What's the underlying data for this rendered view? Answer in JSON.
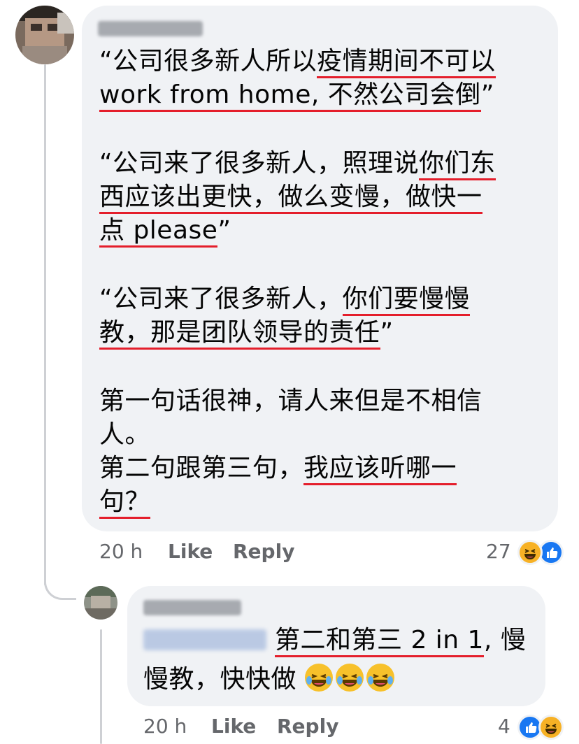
{
  "comment": {
    "author": "",
    "paragraphs": [
      {
        "lines": [
          [
            {
              "t": "“公司很多新人所以",
              "u": false
            },
            {
              "t": "疫情期间不可以",
              "u": true
            }
          ],
          [
            {
              "t": "work from home, 不然公司会倒",
              "u": true
            },
            {
              "t": "”",
              "u": false
            }
          ]
        ]
      },
      {
        "lines": [
          [
            {
              "t": "“公司来了很多新人，照理说",
              "u": false
            },
            {
              "t": "你们东",
              "u": true
            }
          ],
          [
            {
              "t": "西应该出更快，做么变慢，做快一",
              "u": true
            }
          ],
          [
            {
              "t": "点 please",
              "u": true
            },
            {
              "t": "”",
              "u": false
            }
          ]
        ]
      },
      {
        "lines": [
          [
            {
              "t": "“公司来了很多新人，",
              "u": false
            },
            {
              "t": "你们要慢慢",
              "u": true
            }
          ],
          [
            {
              "t": "教，那是团队领导的责任",
              "u": true
            },
            {
              "t": "”",
              "u": false
            }
          ]
        ]
      },
      {
        "lines": [
          [
            {
              "t": "第一句话很神，请人来但是不相信",
              "u": false
            }
          ],
          [
            {
              "t": "人。",
              "u": false
            }
          ],
          [
            {
              "t": "第二句跟第三句，",
              "u": false
            },
            {
              "t": "我应该听哪一",
              "u": true
            }
          ],
          [
            {
              "t": "句？",
              "u": true
            }
          ]
        ]
      }
    ],
    "time": "20 h",
    "like_label": "Like",
    "reply_label": "Reply",
    "reaction_count": "27",
    "reactions": [
      "haha-icon",
      "like-icon"
    ]
  },
  "reply": {
    "author": "",
    "mention": "",
    "lines": [
      [
        {
          "t": "第二和第三 2 in 1",
          "u": true
        },
        {
          "t": ", 慢",
          "u": false
        }
      ],
      [
        {
          "t": "慢教，快快做 ",
          "u": false
        }
      ]
    ],
    "emojis": [
      "crying-laughing-icon",
      "crying-laughing-icon",
      "crying-laughing-icon"
    ],
    "time": "20 h",
    "like_label": "Like",
    "reply_label": "Reply",
    "reaction_count": "4",
    "reactions": [
      "like-icon",
      "haha-icon"
    ]
  },
  "colors": {
    "bubble": "#f0f2f5",
    "underline": "#e41e2b",
    "meta": "#65676b",
    "like_blue": "#1877f2",
    "haha_yellow": "#f7b125"
  }
}
